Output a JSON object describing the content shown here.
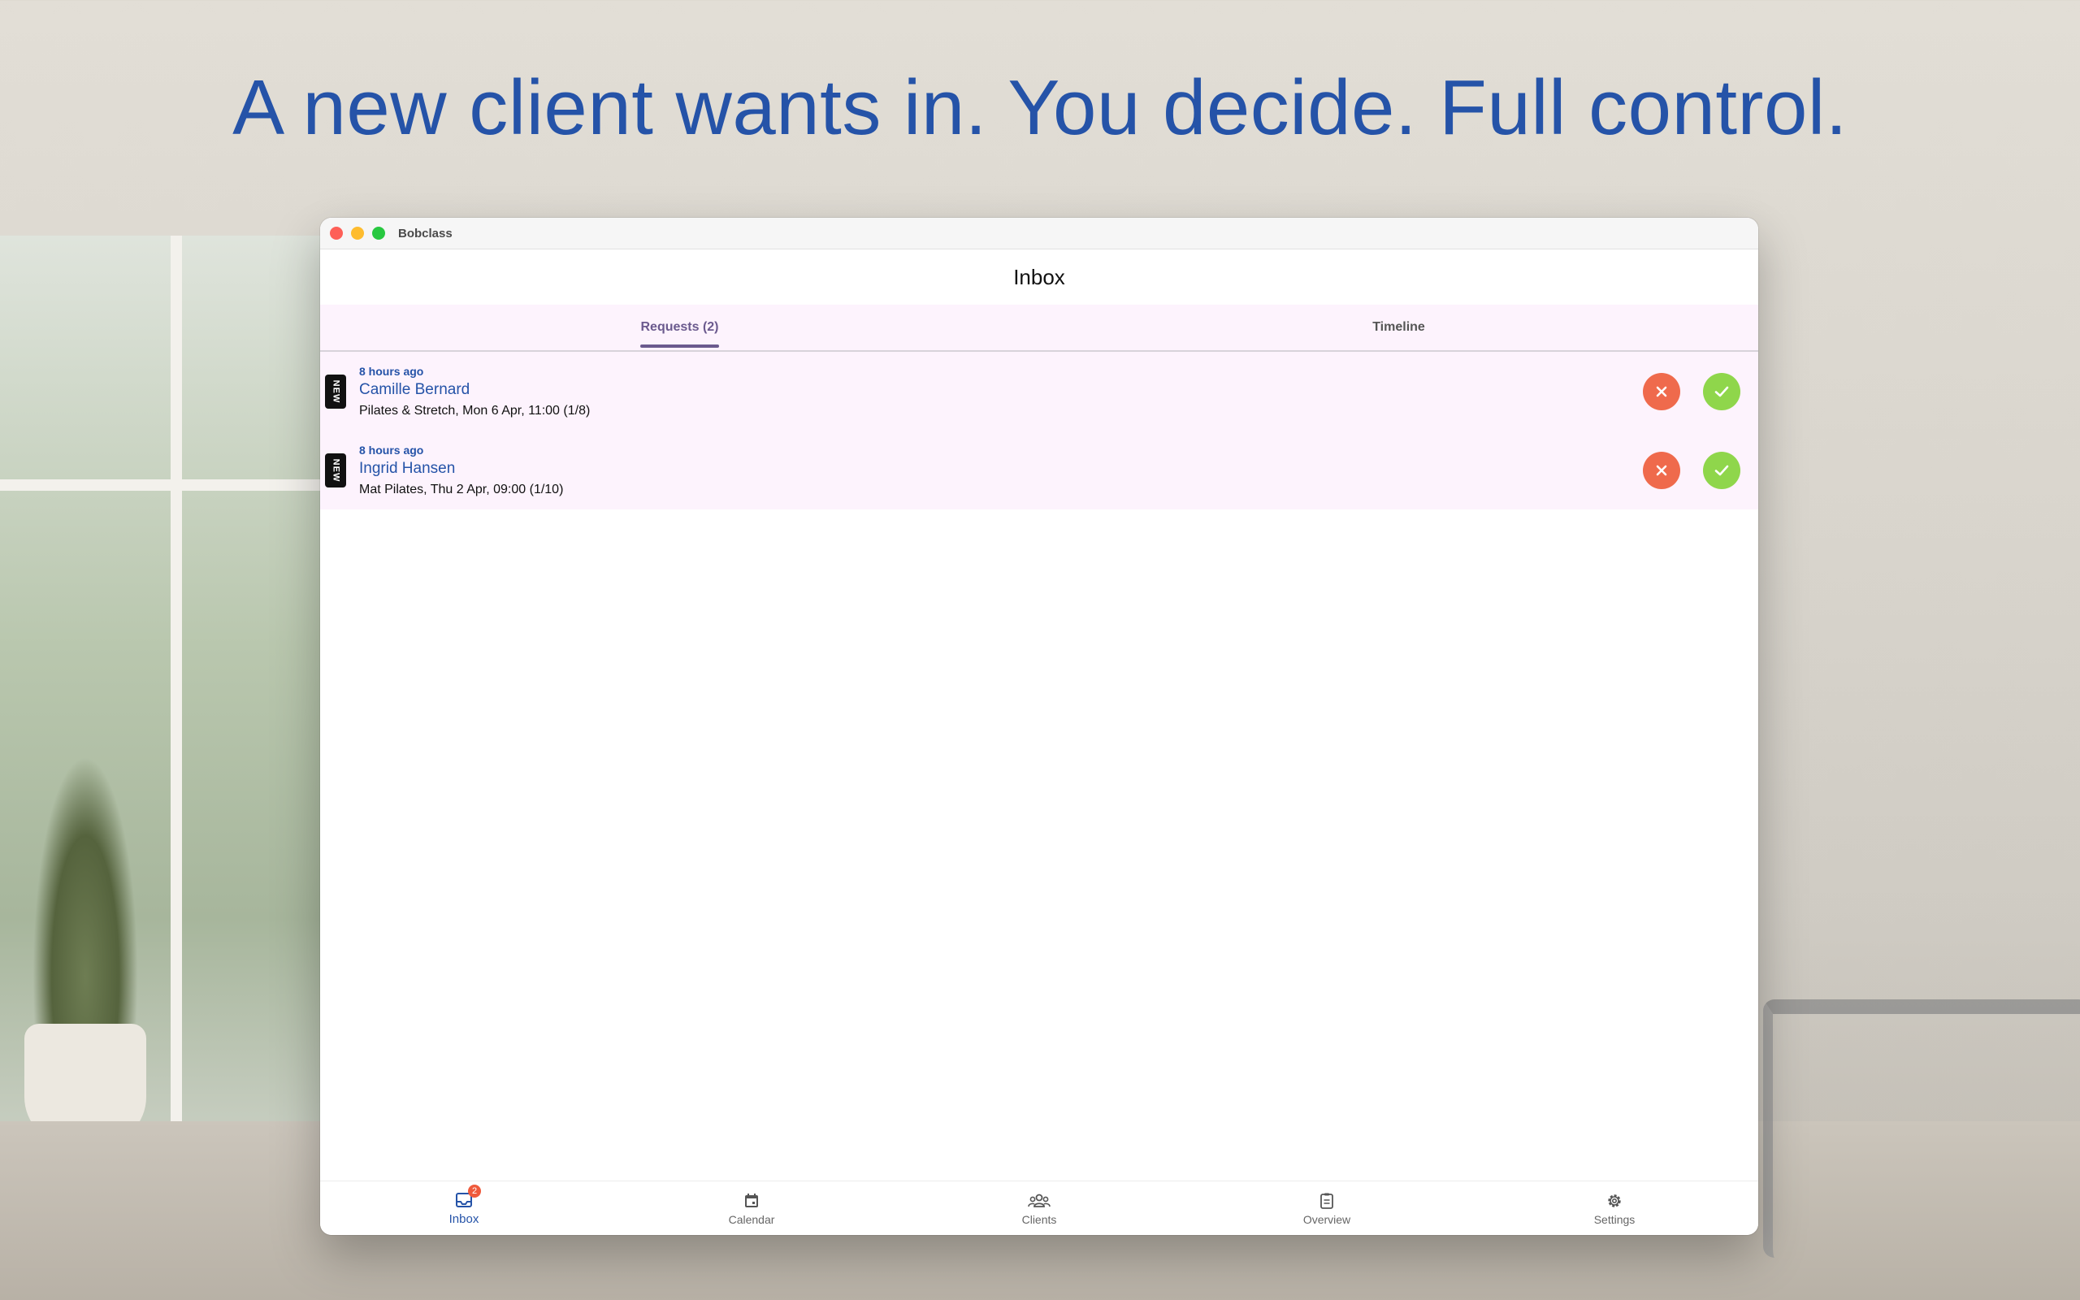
{
  "headline": "A new client wants in. You decide. Full control.",
  "window": {
    "title": "Bobclass"
  },
  "page": {
    "title": "Inbox"
  },
  "tabs": [
    {
      "label": "Requests (2)",
      "active": true
    },
    {
      "label": "Timeline",
      "active": false
    }
  ],
  "requests": [
    {
      "badge": "NEW",
      "time": "8 hours ago",
      "name": "Camille Bernard",
      "detail": "Pilates & Stretch, Mon 6 Apr, 11:00 (1/8)"
    },
    {
      "badge": "NEW",
      "time": "8 hours ago",
      "name": "Ingrid Hansen",
      "detail": "Mat Pilates, Thu 2 Apr, 09:00 (1/10)"
    }
  ],
  "nav": [
    {
      "label": "Inbox",
      "icon": "inbox-icon",
      "badge": "2",
      "active": true
    },
    {
      "label": "Calendar",
      "icon": "calendar-icon",
      "active": false
    },
    {
      "label": "Clients",
      "icon": "clients-icon",
      "active": false
    },
    {
      "label": "Overview",
      "icon": "overview-icon",
      "active": false
    },
    {
      "label": "Settings",
      "icon": "settings-icon",
      "active": false
    }
  ],
  "colors": {
    "accent": "#2553a8",
    "tab_accent": "#6b5a8e",
    "reject": "#ef6a4c",
    "accept": "#8fd64b",
    "row_bg": "#fdf3fd"
  }
}
